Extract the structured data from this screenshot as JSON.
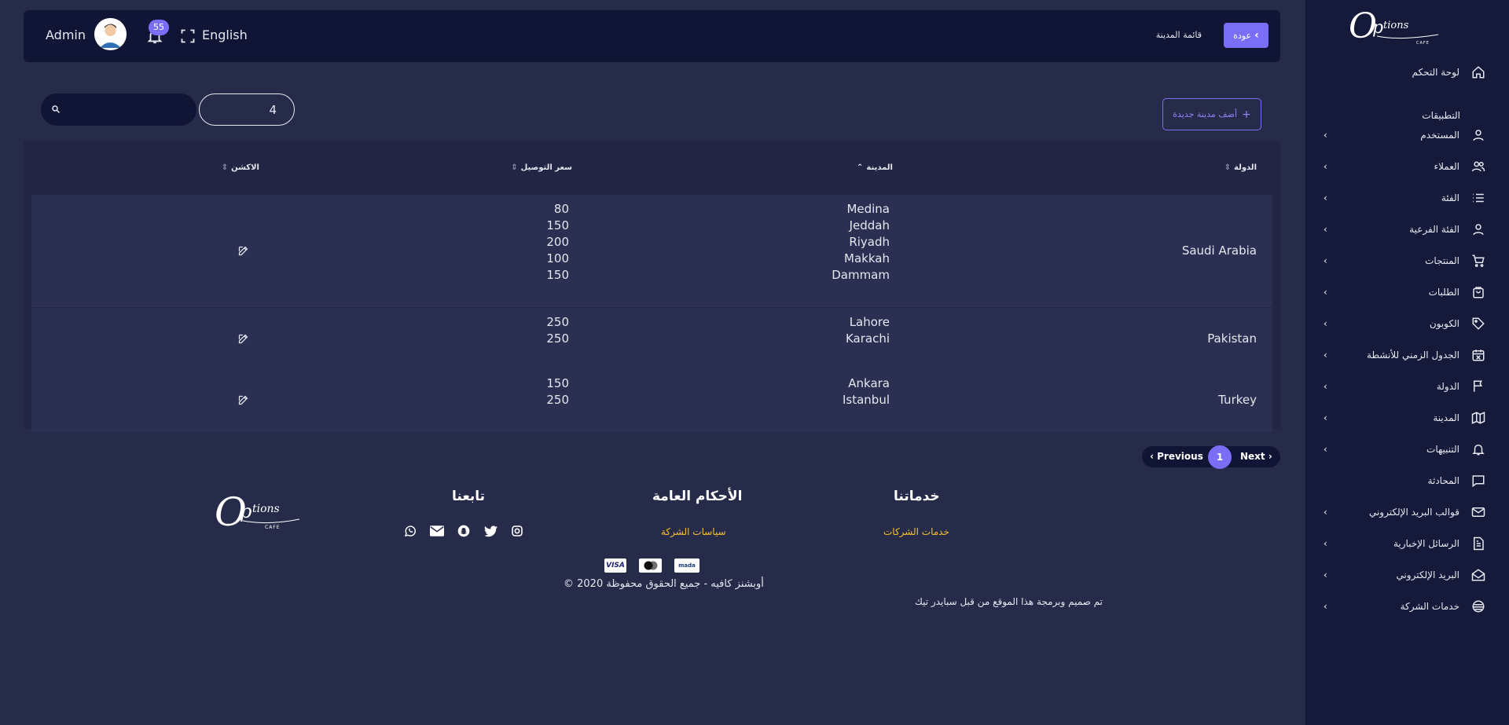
{
  "sidebar": {
    "brand": "Options",
    "brand_sub": "CAFE",
    "dashboard": "لوحة التحكم",
    "section_title": "التطبيقات",
    "items": [
      {
        "label": "المستخدم",
        "icon": "user-icon",
        "has_chevron": true
      },
      {
        "label": "العملاء",
        "icon": "users-icon",
        "has_chevron": true
      },
      {
        "label": "الفئة",
        "icon": "list-icon",
        "has_chevron": true
      },
      {
        "label": "الفئة الفرعية",
        "icon": "user-icon",
        "has_chevron": true
      },
      {
        "label": "المنتجات",
        "icon": "cart-icon",
        "has_chevron": true
      },
      {
        "label": "الطلبات",
        "icon": "bag-icon",
        "has_chevron": true
      },
      {
        "label": "الكوبون",
        "icon": "tag-icon",
        "has_chevron": true
      },
      {
        "label": "الجدول الزمني للأنشطة",
        "icon": "calendar-x-icon",
        "has_chevron": true
      },
      {
        "label": "الدولة",
        "icon": "flag-icon",
        "has_chevron": true
      },
      {
        "label": "المدينة",
        "icon": "map-icon",
        "has_chevron": true
      },
      {
        "label": "التنبيهات",
        "icon": "bell-icon",
        "has_chevron": true
      },
      {
        "label": "المحادثة",
        "icon": "chat-icon",
        "has_chevron": false
      },
      {
        "label": "قوالب البريد الإلكتروني",
        "icon": "mail-icon",
        "has_chevron": true
      },
      {
        "label": "الرسائل الإخبارية",
        "icon": "document-icon",
        "has_chevron": true
      },
      {
        "label": "البريد الإلكتروني",
        "icon": "mail-open-icon",
        "has_chevron": true
      },
      {
        "label": "خدمات الشركة",
        "icon": "services-icon",
        "has_chevron": true
      }
    ]
  },
  "topbar": {
    "user": "Admin",
    "notifications": "55",
    "language": "English",
    "back": "عودة",
    "breadcrumb": "قائمة المدينة"
  },
  "controls": {
    "page_size": "4",
    "search_value": "",
    "add_button": "أضف مدينة جديدة"
  },
  "table": {
    "headers": {
      "country": "الدولة",
      "city": "المدينة",
      "delivery_price": "سعر التوصيل",
      "action": "الاكشن"
    },
    "rows": [
      {
        "country": "Saudi Arabia",
        "cities": [
          "Medina",
          "Jeddah",
          "Riyadh",
          "Makkah",
          "Dammam"
        ],
        "prices": [
          "80",
          "150",
          "200",
          "100",
          "150"
        ]
      },
      {
        "country": "Pakistan",
        "cities": [
          "Lahore",
          "Karachi"
        ],
        "prices": [
          "250",
          "250"
        ]
      },
      {
        "country": "Turkey",
        "cities": [
          "Ankara",
          "Istanbul"
        ],
        "prices": [
          "150",
          "250"
        ]
      }
    ]
  },
  "pagination": {
    "previous": "Previous",
    "current": "1",
    "next": "Next"
  },
  "footer": {
    "services_heading": "خدماتنا",
    "services_link": "خدمات الشركات",
    "terms_heading": "الأحكام العامة",
    "terms_link": "سياسات الشركة",
    "follow_heading": "تابعنا",
    "social": [
      "instagram-icon",
      "twitter-icon",
      "snapchat-icon",
      "email-icon",
      "whatsapp-icon"
    ],
    "payments": [
      "mada",
      "mastercard",
      "VISA"
    ],
    "copyright": "© 2020 أوبشنز كافيه - جميع الحقوق محفوظة",
    "credit": "تم صميم وبرمجة هذا الموقع من قبل سبايدر تيك",
    "accent_color": "#f2c12e"
  },
  "colors": {
    "accent": "#7b6ef6",
    "background": "#272b4a",
    "sidebar": "#161a3a"
  }
}
